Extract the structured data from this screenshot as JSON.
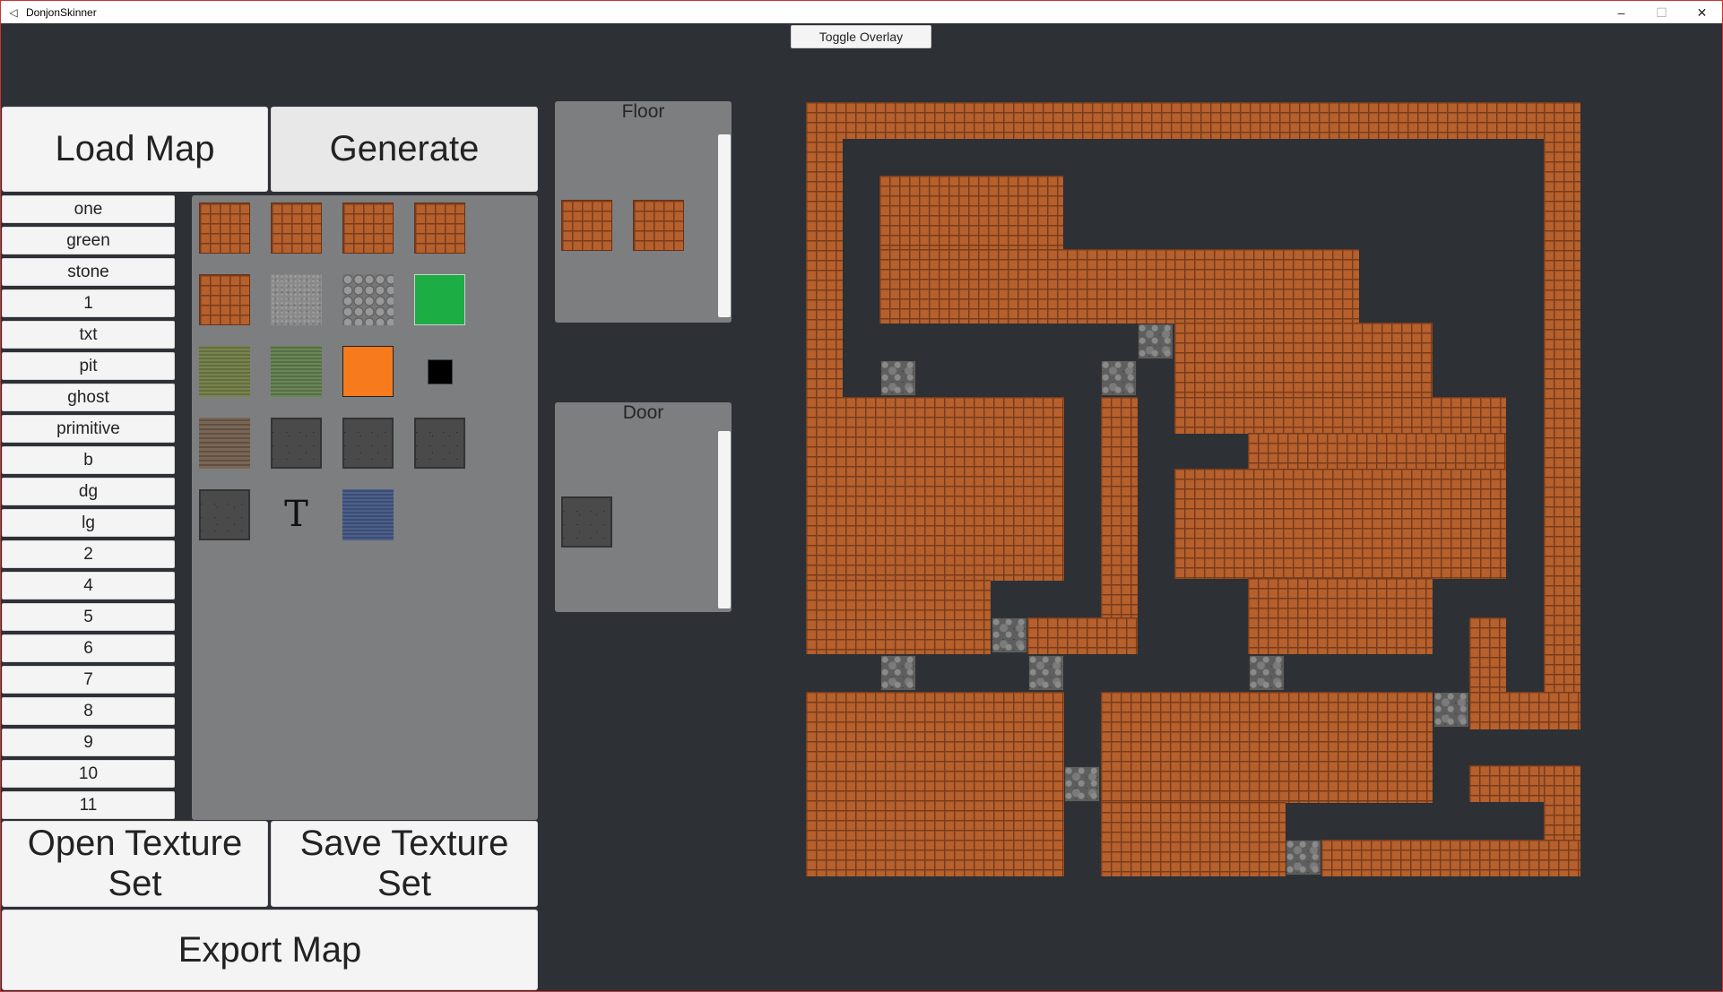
{
  "window": {
    "title": "DonjonSkinner",
    "minimize": "–",
    "maximize": "☐",
    "close": "✕",
    "icon": "unity-icon"
  },
  "toolbar": {
    "toggle_overlay": "Toggle Overlay"
  },
  "buttons": {
    "load_map": "Load Map",
    "generate": "Generate",
    "open_texture_set": "Open Texture Set",
    "save_texture_set": "Save Texture Set",
    "export_map": "Export Map"
  },
  "texture_names": [
    "one",
    "green",
    "stone",
    "1",
    "txt",
    "pit",
    "ghost",
    "primitive",
    "b",
    "dg",
    "lg",
    "2",
    "4",
    "5",
    "6",
    "7",
    "8",
    "9",
    "10",
    "11"
  ],
  "texture_palette": {
    "letter_tile": "T"
  },
  "panels": {
    "floor_title": "Floor",
    "door_title": "Door"
  },
  "colors": {
    "background": "#2d3035",
    "panel": "#7d7e80",
    "button": "#f4f4f4",
    "brick": "#b5602d",
    "green": "#1cad44",
    "orange": "#f77a1d"
  }
}
